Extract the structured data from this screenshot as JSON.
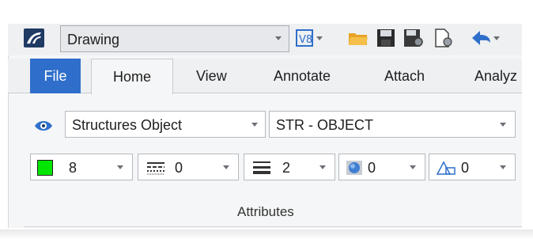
{
  "quick_access": {
    "workspace_value": "Drawing",
    "icons": [
      "app-logo-icon",
      "v8-icon",
      "open-folder-icon",
      "save-icon",
      "save-settings-icon",
      "properties-icon",
      "undo-icon"
    ]
  },
  "tabs": [
    "File",
    "Home",
    "View",
    "Annotate",
    "Attach",
    "Analyz"
  ],
  "active_tab": "Home",
  "attributes": {
    "level_value": "Structures Object",
    "style_value": "STR - OBJECT",
    "color_value": "8",
    "line_style_value": "0",
    "line_weight_value": "2",
    "transparency_value": "0",
    "priority_value": "0",
    "group_label": "Attributes"
  },
  "colors": {
    "accent": "#2f6fcb",
    "swatch": "#00e600"
  }
}
